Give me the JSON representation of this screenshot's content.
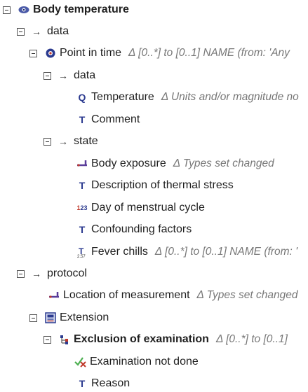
{
  "tree": {
    "root": {
      "label": "Body temperature",
      "icon": "eye-icon"
    },
    "data1": {
      "label": "data"
    },
    "point_in_time": {
      "label": "Point in time",
      "note": "Δ [0..*] to [0..1]   NAME (from: 'Any"
    },
    "data2": {
      "label": "data"
    },
    "temperature": {
      "label": "Temperature",
      "note": "Δ Units and/or magnitude no"
    },
    "comment": {
      "label": "Comment"
    },
    "state": {
      "label": "state"
    },
    "body_exposure": {
      "label": "Body exposure",
      "note": "Δ Types set changed"
    },
    "description": {
      "label": "Description of thermal stress"
    },
    "day_menstrual": {
      "label": "Day of menstrual cycle"
    },
    "confounding": {
      "label": "Confounding factors"
    },
    "fever_chills": {
      "label": "Fever chills",
      "note": "Δ [0..*] to [0..1]   NAME (from: '"
    },
    "protocol": {
      "label": "protocol"
    },
    "location": {
      "label": "Location of measurement",
      "note": "Δ Types set changed"
    },
    "extension": {
      "label": "Extension"
    },
    "exclusion": {
      "label": "Exclusion of examination",
      "note": "Δ [0..*] to [0..1]"
    },
    "exam_not_done": {
      "label": "Examination not done"
    },
    "reason": {
      "label": "Reason"
    }
  },
  "colors": {
    "accent_blue": "#2b3a8f",
    "note_gray": "#777777",
    "icon_purple": "#5a3d9a"
  }
}
